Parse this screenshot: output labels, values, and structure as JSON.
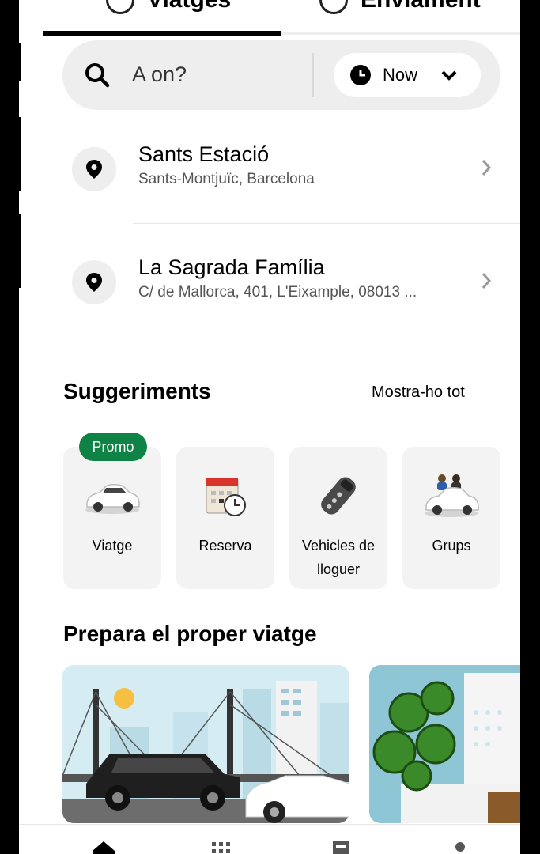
{
  "top_tabs": [
    {
      "label": "Viatges",
      "active": true
    },
    {
      "label": "Enviament",
      "active": false
    }
  ],
  "search": {
    "placeholder": "A on?",
    "time_button_label": "Now"
  },
  "saved_places": [
    {
      "title": "Sants Estació",
      "subtitle": "Sants-Montjuïc, Barcelona"
    },
    {
      "title": "La Sagrada Família",
      "subtitle": "C/ de Mallorca, 401, L'Eixample, 08013 ..."
    }
  ],
  "suggestions": {
    "title": "Suggeriments",
    "see_all": "Mostra-ho tot",
    "promo_badge": "Promo",
    "items": [
      {
        "label": "Viatge",
        "icon": "car-icon"
      },
      {
        "label": "Reserva",
        "icon": "calendar-clock-icon"
      },
      {
        "label": "Vehicles de lloguer",
        "icon": "key-fob-icon"
      },
      {
        "label": "Grups",
        "icon": "group-car-icon"
      }
    ]
  },
  "prepare": {
    "title": "Prepara el proper viatge"
  },
  "bottom_nav": [
    {
      "icon": "home-icon",
      "active": true
    },
    {
      "icon": "services-grid-icon",
      "active": false
    },
    {
      "icon": "activity-icon",
      "active": false
    },
    {
      "icon": "account-icon",
      "active": false
    }
  ],
  "colors": {
    "promo_green": "#0e8345",
    "search_bg": "#eeeeee",
    "card_bg": "#f3f3f3"
  }
}
